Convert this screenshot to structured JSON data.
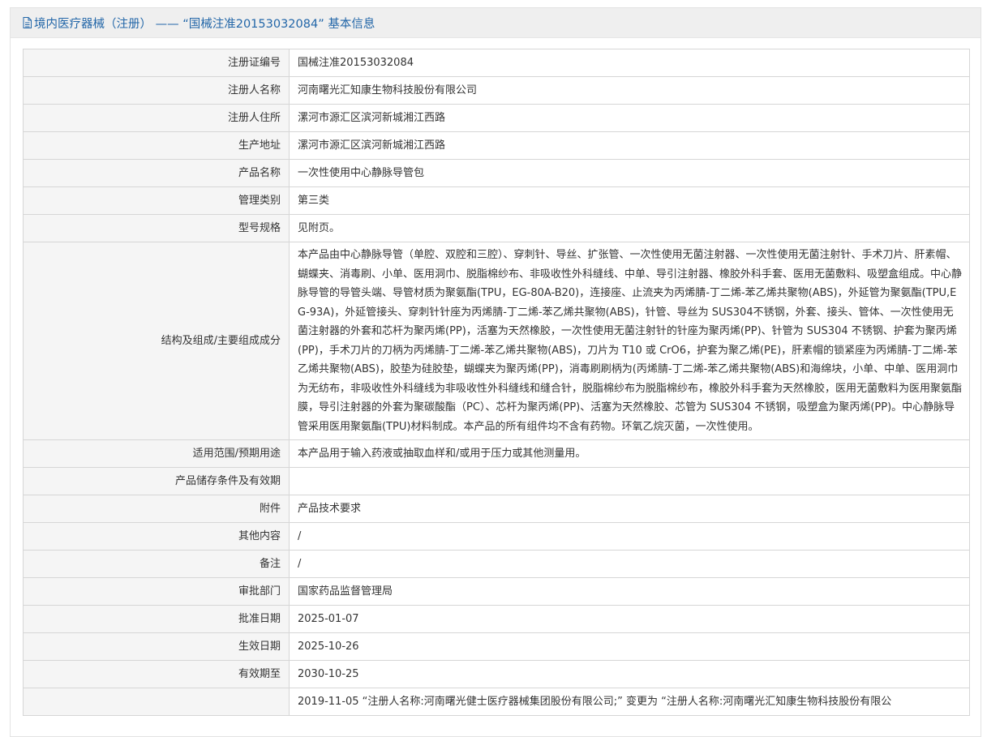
{
  "header": {
    "icon": "document-icon",
    "title": "境内医疗器械（注册） —— “国械注准20153032084” 基本信息",
    "color": "#2266a8"
  },
  "rows": [
    {
      "label": "注册证编号",
      "value": "国械注准20153032084"
    },
    {
      "label": "注册人名称",
      "value": "河南曙光汇知康生物科技股份有限公司"
    },
    {
      "label": "注册人住所",
      "value": "漯河市源汇区滨河新城湘江西路"
    },
    {
      "label": "生产地址",
      "value": "漯河市源汇区滨河新城湘江西路"
    },
    {
      "label": "产品名称",
      "value": "一次性使用中心静脉导管包"
    },
    {
      "label": "管理类别",
      "value": "第三类"
    },
    {
      "label": "型号规格",
      "value": "见附页。"
    },
    {
      "label": "结构及组成/主要组成成分",
      "value": "本产品由中心静脉导管（单腔、双腔和三腔）、穿刺针、导丝、扩张管、一次性使用无菌注射器、一次性使用无菌注射针、手术刀片、肝素帽、蝴蝶夹、消毒刷、小单、医用洞巾、脱脂棉纱布、非吸收性外科缝线、中单、导引注射器、橡胶外科手套、医用无菌敷料、吸塑盒组成。中心静脉导管的导管头端、导管材质为聚氨酯(TPU，EG-80A-B20)，连接座、止流夹为丙烯腈-丁二烯-苯乙烯共聚物(ABS)，外延管为聚氨酯(TPU,EG-93A)，外延管接头、穿刺针针座为丙烯腈-丁二烯-苯乙烯共聚物(ABS)，针管、导丝为 SUS304不锈钢，外套、接头、管体、一次性使用无菌注射器的外套和芯杆为聚丙烯(PP)，活塞为天然橡胶，一次性使用无菌注射针的针座为聚丙烯(PP)、针管为 SUS304 不锈钢、护套为聚丙烯(PP)，手术刀片的刀柄为丙烯腈-丁二烯-苯乙烯共聚物(ABS)，刀片为 T10 或 CrO6，护套为聚乙烯(PE)，肝素帽的锁紧座为丙烯腈-丁二烯-苯乙烯共聚物(ABS)，胶垫为硅胶垫，蝴蝶夹为聚丙烯(PP)，消毒刷刷柄为(丙烯腈-丁二烯-苯乙烯共聚物(ABS)和海绵块，小单、中单、医用洞巾为无纺布，非吸收性外科缝线为非吸收性外科缝线和缝合针，脱脂棉纱布为脱脂棉纱布，橡胶外科手套为天然橡胶，医用无菌敷料为医用聚氨酯膜，导引注射器的外套为聚碳酸酯（PC）、芯杆为聚丙烯(PP)、活塞为天然橡胶、芯管为 SUS304 不锈钢，吸塑盒为聚丙烯(PP)。中心静脉导管采用医用聚氨酯(TPU)材料制成。本产品的所有组件均不含有药物。环氧乙烷灭菌，一次性使用。"
    },
    {
      "label": "适用范围/预期用途",
      "value": "本产品用于输入药液或抽取血样和/或用于压力或其他测量用。"
    },
    {
      "label": "产品储存条件及有效期",
      "value": ""
    },
    {
      "label": "附件",
      "value": "产品技术要求"
    },
    {
      "label": "其他内容",
      "value": "/"
    },
    {
      "label": "备注",
      "value": "/"
    },
    {
      "label": "审批部门",
      "value": "国家药品监督管理局"
    },
    {
      "label": "批准日期",
      "value": "2025-01-07"
    },
    {
      "label": "生效日期",
      "value": "2025-10-26"
    },
    {
      "label": "有效期至",
      "value": "2030-10-25"
    },
    {
      "label": "",
      "value": "2019-11-05 “注册人名称:河南曙光健士医疗器械集团股份有限公司;” 变更为 “注册人名称:河南曙光汇知康生物科技股份有限公"
    }
  ]
}
